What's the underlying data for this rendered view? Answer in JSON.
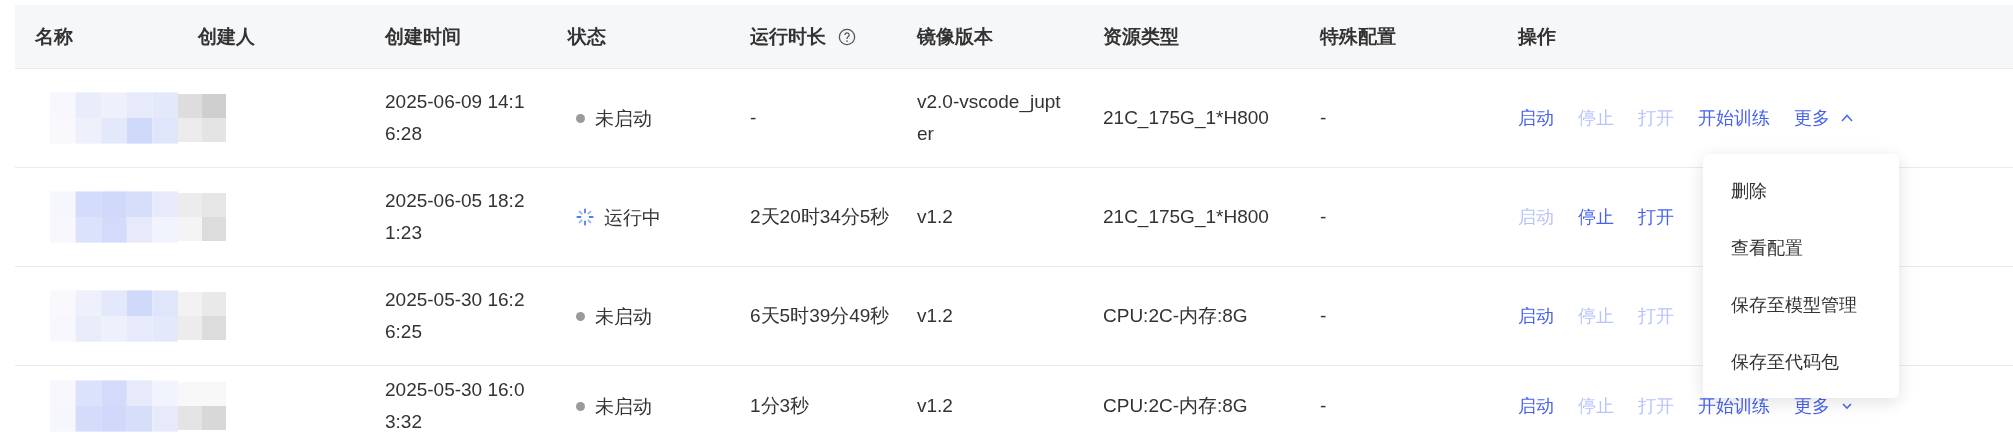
{
  "table": {
    "columns": [
      {
        "label": "名称"
      },
      {
        "label": "创建人"
      },
      {
        "label": "创建时间"
      },
      {
        "label": "状态"
      },
      {
        "label": "运行时长",
        "help": true
      },
      {
        "label": "镜像版本"
      },
      {
        "label": "资源类型"
      },
      {
        "label": "特殊配置"
      },
      {
        "label": "操作"
      }
    ],
    "rows": [
      {
        "created": "2025-06-09 14:16:28",
        "status": {
          "kind": "stopped",
          "label": "未启动"
        },
        "duration": "-",
        "image": "v2.0-vscode_jupter",
        "resource": "21C_175G_1*H800",
        "special": "-",
        "actions": [
          {
            "label": "启动",
            "disabled": false
          },
          {
            "label": "停止",
            "disabled": true
          },
          {
            "label": "打开",
            "disabled": true
          },
          {
            "label": "开始训练",
            "disabled": false
          }
        ],
        "more": {
          "label": "更多",
          "expanded": true
        }
      },
      {
        "created": "2025-06-05 18:21:23",
        "status": {
          "kind": "running",
          "label": "运行中"
        },
        "duration": "2天20时34分5秒",
        "image": "v1.2",
        "resource": "21C_175G_1*H800",
        "special": "-",
        "actions": [
          {
            "label": "启动",
            "disabled": true
          },
          {
            "label": "停止",
            "disabled": false
          },
          {
            "label": "打开",
            "disabled": false
          }
        ]
      },
      {
        "created": "2025-05-30 16:26:25",
        "status": {
          "kind": "stopped",
          "label": "未启动"
        },
        "duration": "6天5时39分49秒",
        "image": "v1.2",
        "resource": "CPU:2C-内存:8G",
        "special": "-",
        "actions": [
          {
            "label": "启动",
            "disabled": false
          },
          {
            "label": "停止",
            "disabled": true
          },
          {
            "label": "打开",
            "disabled": true
          }
        ]
      },
      {
        "created": "2025-05-30 16:03:32",
        "status": {
          "kind": "stopped",
          "label": "未启动"
        },
        "duration": "1分3秒",
        "image": "v1.2",
        "resource": "CPU:2C-内存:8G",
        "special": "-",
        "actions": [
          {
            "label": "启动",
            "disabled": false
          },
          {
            "label": "停止",
            "disabled": true
          },
          {
            "label": "打开",
            "disabled": true
          },
          {
            "label": "开始训练",
            "disabled": false
          }
        ],
        "more": {
          "label": "更多",
          "expanded": false
        }
      }
    ]
  },
  "more_menu": {
    "items": [
      {
        "label": "删除"
      },
      {
        "label": "查看配置"
      },
      {
        "label": "保存至模型管理"
      },
      {
        "label": "保存至代码包"
      }
    ]
  }
}
